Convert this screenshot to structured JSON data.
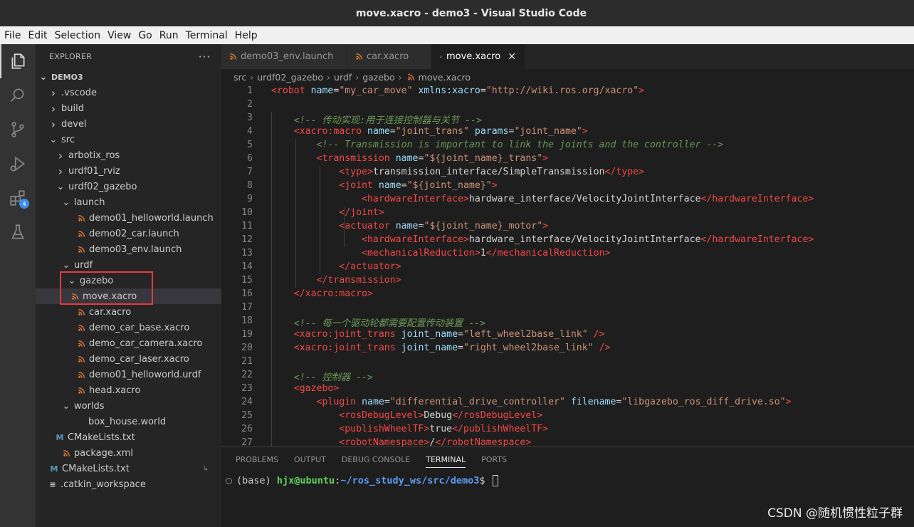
{
  "window": {
    "title": "move.xacro - demo3 - Visual Studio Code"
  },
  "menu": [
    "File",
    "Edit",
    "Selection",
    "View",
    "Go",
    "Run",
    "Terminal",
    "Help"
  ],
  "activity_bar": {
    "extensions_badge": "4"
  },
  "explorer": {
    "header": "EXPLORER",
    "more": "···",
    "root": "DEMO3",
    "items": [
      {
        "label": ".vscode",
        "type": "folder",
        "expanded": false
      },
      {
        "label": "build",
        "type": "folder",
        "expanded": false
      },
      {
        "label": "devel",
        "type": "folder",
        "expanded": false
      },
      {
        "label": "src",
        "type": "folder",
        "expanded": true
      },
      {
        "label": "arbotix_ros",
        "type": "folder",
        "expanded": false
      },
      {
        "label": "urdf01_rviz",
        "type": "folder",
        "expanded": false
      },
      {
        "label": "urdf02_gazebo",
        "type": "folder",
        "expanded": true
      },
      {
        "label": "launch",
        "type": "folder",
        "expanded": true
      },
      {
        "label": "demo01_helloworld.launch",
        "type": "rss"
      },
      {
        "label": "demo02_car.launch",
        "type": "rss"
      },
      {
        "label": "demo03_env.launch",
        "type": "rss"
      },
      {
        "label": "urdf",
        "type": "folder",
        "expanded": true
      },
      {
        "label": "gazebo",
        "type": "folder",
        "expanded": true
      },
      {
        "label": "move.xacro",
        "type": "rss",
        "selected": true
      },
      {
        "label": "car.xacro",
        "type": "rss"
      },
      {
        "label": "demo_car_base.xacro",
        "type": "rss"
      },
      {
        "label": "demo_car_camera.xacro",
        "type": "rss"
      },
      {
        "label": "demo_car_laser.xacro",
        "type": "rss"
      },
      {
        "label": "demo01_helloworld.urdf",
        "type": "rss"
      },
      {
        "label": "head.xacro",
        "type": "rss"
      },
      {
        "label": "worlds",
        "type": "folder",
        "expanded": true
      },
      {
        "label": "box_house.world",
        "type": "file"
      },
      {
        "label": "CMakeLists.txt",
        "type": "cmake",
        "icon": "M"
      },
      {
        "label": "package.xml",
        "type": "rss"
      },
      {
        "label": "CMakeLists.txt",
        "type": "cmake",
        "icon": "M",
        "link_arrow": "↳"
      },
      {
        "label": ".catkin_workspace",
        "type": "text",
        "icon": "≡"
      }
    ]
  },
  "tabs": [
    {
      "label": "demo03_env.launch",
      "active": false
    },
    {
      "label": "car.xacro",
      "active": false
    },
    {
      "label": "move.xacro",
      "active": true,
      "close": "✕"
    }
  ],
  "breadcrumb": [
    "src",
    "urdf02_gazebo",
    "urdf",
    "gazebo",
    "move.xacro"
  ],
  "breadcrumb_sep": "›",
  "editor": {
    "lines": [
      "<robot name=\"my_car_move\" xmlns:xacro=\"http://wiki.ros.org/xacro\">",
      "",
      "    <!-- 传动实现:用于连接控制器与关节 -->",
      "    <xacro:macro name=\"joint_trans\" params=\"joint_name\">",
      "        <!-- Transmission is important to link the joints and the controller -->",
      "        <transmission name=\"${joint_name}_trans\">",
      "            <type>transmission_interface/SimpleTransmission</type>",
      "            <joint name=\"${joint_name}\">",
      "                <hardwareInterface>hardware_interface/VelocityJointInterface</hardwareInterface>",
      "            </joint>",
      "            <actuator name=\"${joint_name}_motor\">",
      "                <hardwareInterface>hardware_interface/VelocityJointInterface</hardwareInterface>",
      "                <mechanicalReduction>1</mechanicalReduction>",
      "            </actuator>",
      "        </transmission>",
      "    </xacro:macro>",
      "",
      "    <!-- 每一个驱动轮都需要配置传动装置 -->",
      "    <xacro:joint_trans joint_name=\"left_wheel2base_link\" />",
      "    <xacro:joint_trans joint_name=\"right_wheel2base_link\" />",
      "",
      "    <!-- 控制器 -->",
      "    <gazebo>",
      "        <plugin name=\"differential_drive_controller\" filename=\"libgazebo_ros_diff_drive.so\">",
      "            <rosDebugLevel>Debug</rosDebugLevel>",
      "            <publishWheelTF>true</publishWheelTF>",
      "            <robotNamespace>/</robotNamespace>"
    ]
  },
  "panel": {
    "tabs": [
      "PROBLEMS",
      "OUTPUT",
      "DEBUG CONSOLE",
      "TERMINAL",
      "PORTS"
    ],
    "active_tab": "TERMINAL",
    "terminal": {
      "env": "(base) ",
      "user": "hjx@ubuntu",
      "sep": ":",
      "path": "~/ros_study_ws/src/demo3",
      "prompt": "$ "
    }
  },
  "watermark": "CSDN @随机惯性粒子群"
}
